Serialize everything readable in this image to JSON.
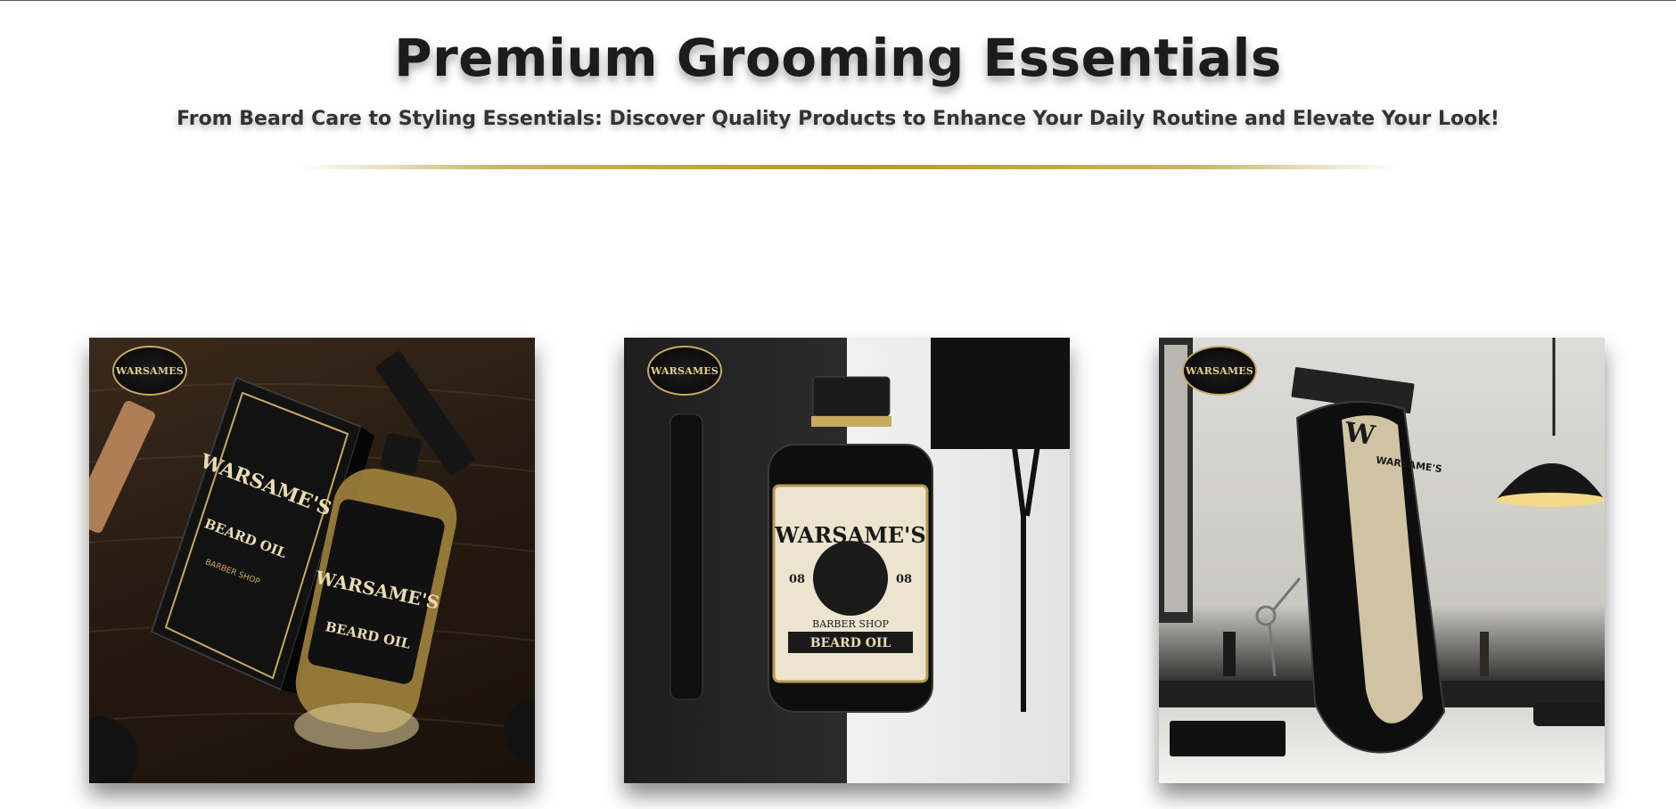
{
  "hero": {
    "title": "Premium Grooming Essentials",
    "subtitle": "From Beard Care to Styling Essentials: Discover Quality Products to Enhance Your Daily Routine and Elevate Your Look!"
  },
  "products": [
    {
      "badge": "WARSAMES",
      "box_brand": "WARSAME'S",
      "box_label": "BEARD OIL",
      "box_sub": "BARBER SHOP",
      "bottle_brand": "WARSAME'S",
      "bottle_label": "BEARD OIL"
    },
    {
      "badge": "WARSAMES",
      "bottle_brand": "WARSAME'S",
      "bottle_badge_left": "08",
      "bottle_badge_right": "08",
      "bottle_sub": "BARBER SHOP",
      "bottle_label": "BEARD OIL"
    },
    {
      "badge": "WARSAMES",
      "clipper_brand": "WARSAME'S",
      "clipper_mark": "W"
    }
  ],
  "colors": {
    "accent_gold": "#b39a2c",
    "title_text": "#1c1c1c",
    "subtitle_text": "#333333"
  }
}
